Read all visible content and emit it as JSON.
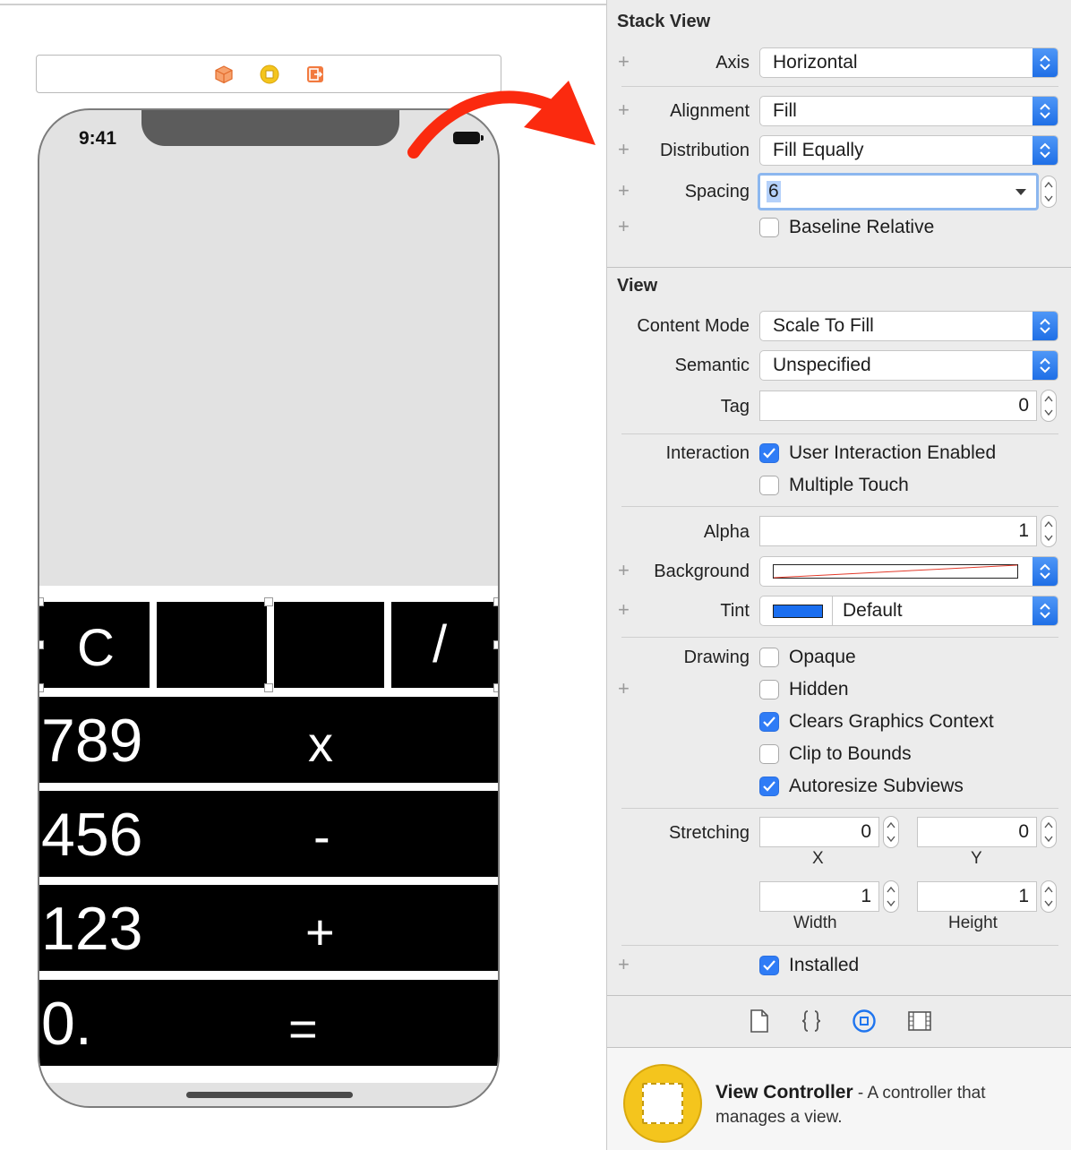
{
  "canvas": {
    "status_time": "9:41",
    "keypad": {
      "top_row": [
        "C",
        "",
        "",
        "/"
      ],
      "rows": [
        {
          "digits": "789",
          "operator": "x"
        },
        {
          "digits": "456",
          "operator": "-"
        },
        {
          "digits": "123",
          "operator": "+"
        },
        {
          "digits": "0.",
          "operator": "="
        }
      ]
    }
  },
  "inspector": {
    "stack_view": {
      "title": "Stack View",
      "axis_label": "Axis",
      "axis_value": "Horizontal",
      "alignment_label": "Alignment",
      "alignment_value": "Fill",
      "distribution_label": "Distribution",
      "distribution_value": "Fill Equally",
      "spacing_label": "Spacing",
      "spacing_value": "6",
      "baseline_label": "Baseline Relative"
    },
    "view": {
      "title": "View",
      "content_mode_label": "Content Mode",
      "content_mode_value": "Scale To Fill",
      "semantic_label": "Semantic",
      "semantic_value": "Unspecified",
      "tag_label": "Tag",
      "tag_value": "0",
      "interaction_label": "Interaction",
      "user_interaction_label": "User Interaction Enabled",
      "multiple_touch_label": "Multiple Touch",
      "alpha_label": "Alpha",
      "alpha_value": "1",
      "background_label": "Background",
      "tint_label": "Tint",
      "tint_value": "Default",
      "tint_color": "#1a6ef0",
      "drawing_label": "Drawing",
      "opaque_label": "Opaque",
      "hidden_label": "Hidden",
      "clears_label": "Clears Graphics Context",
      "clip_label": "Clip to Bounds",
      "autoresize_label": "Autoresize Subviews",
      "stretching_label": "Stretching",
      "stretch_x": "0",
      "stretch_y": "0",
      "stretch_width": "1",
      "stretch_height": "1",
      "x_caption": "X",
      "y_caption": "Y",
      "width_caption": "Width",
      "height_caption": "Height",
      "installed_label": "Installed"
    },
    "library": {
      "title": "View Controller",
      "description": " - A controller that manages a view."
    }
  }
}
